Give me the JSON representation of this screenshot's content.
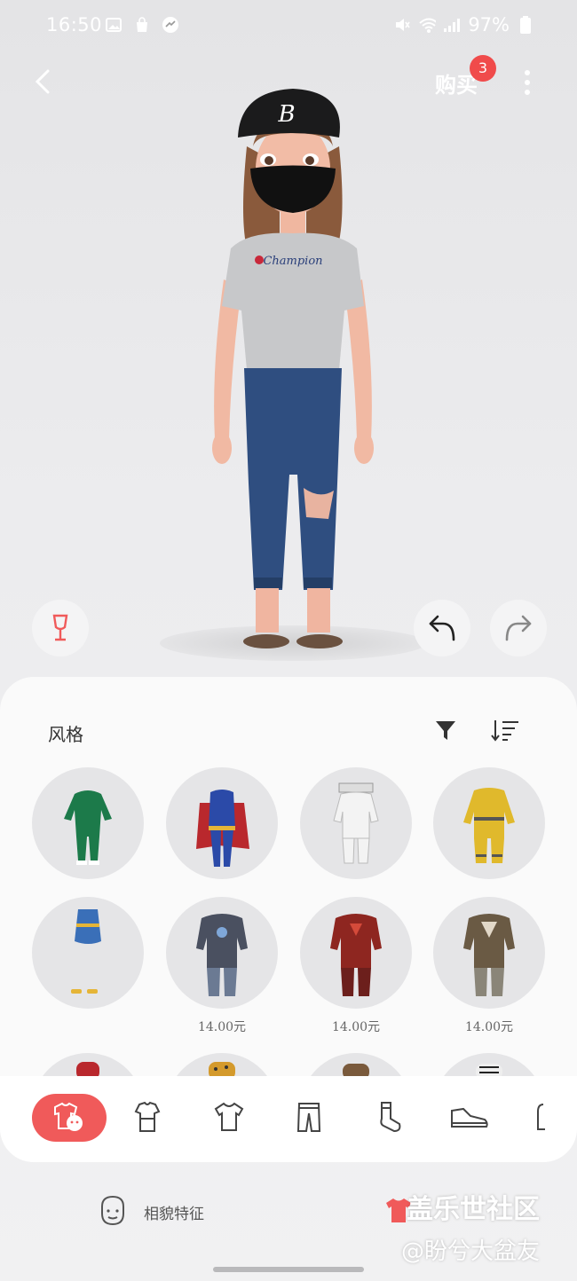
{
  "status_bar": {
    "time": "16:50",
    "battery": "97%"
  },
  "topbar": {
    "buy_label": "购买",
    "buy_badge": "3"
  },
  "sheet": {
    "title": "风格",
    "items": [
      {
        "name": "green-tracksuit",
        "price": ""
      },
      {
        "name": "superhero-suit",
        "price": ""
      },
      {
        "name": "astronaut-suit",
        "price": ""
      },
      {
        "name": "firefighter-suit",
        "price": ""
      },
      {
        "name": "blue-dress",
        "price": ""
      },
      {
        "name": "silver-armor",
        "price": "14.00元"
      },
      {
        "name": "red-armor",
        "price": "14.00元"
      },
      {
        "name": "bronze-armor",
        "price": "14.00元"
      }
    ]
  },
  "tabs": [
    "style-icon",
    "shirt-dress-icon",
    "tshirt-icon",
    "pants-icon",
    "socks-icon",
    "shoes-icon",
    "accessory-icon"
  ],
  "bottom": {
    "face_label": "相貌特征"
  },
  "watermark": {
    "line1": "盖乐世社区",
    "line2": "@盼兮大盆友"
  },
  "colors": {
    "accent": "#f05a5a",
    "badge": "#f04b4b"
  }
}
